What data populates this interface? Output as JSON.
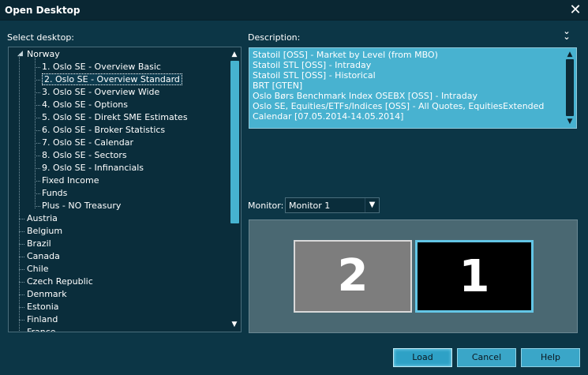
{
  "window": {
    "title": "Open Desktop",
    "close_label": "✕"
  },
  "labels": {
    "select_desktop": "Select desktop:",
    "description": "Description:",
    "monitor": "Monitor:"
  },
  "tree": {
    "root": "Norway",
    "children": [
      "1. Oslo SE - Overview Basic",
      "2. Oslo SE - Overview Standard",
      "3. Oslo SE - Overview Wide",
      "4. Oslo SE - Options",
      "5. Oslo SE - Direkt SME Estimates",
      "6. Oslo SE - Broker Statistics",
      "7. Oslo SE - Calendar",
      "8. Oslo SE - Sectors",
      "9. Oslo SE - Infinancials",
      "Fixed Income",
      "Funds",
      "Plus - NO Treasury"
    ],
    "selected_index": 1,
    "countries": [
      "Austria",
      "Belgium",
      "Brazil",
      "Canada",
      "Chile",
      "Czech Republic",
      "Denmark",
      "Estonia",
      "Finland",
      "France"
    ]
  },
  "description": {
    "lines": [
      "Statoil [OSS] - Market by Level (from MBO)",
      "Statoil STL [OSS] - Intraday",
      "Statoil STL [OSS] - Historical",
      "BRT [GTEN]",
      "Oslo Børs Benchmark Index OSEBX [OSS] - Intraday",
      "Oslo SE, Equities/ETFs/Indices [OSS] - All Quotes, EquitiesExtended",
      "Calendar [07.05.2014-14.05.2014]"
    ]
  },
  "monitor": {
    "selected": "Monitor 1",
    "screens": [
      "2",
      "1"
    ]
  },
  "buttons": {
    "load": "Load",
    "cancel": "Cancel",
    "help": "Help"
  },
  "icons": {
    "close": "close-icon",
    "collapse": "chevron-double-down-icon",
    "scroll_up": "scroll-up-icon",
    "scroll_down": "scroll-down-icon",
    "dropdown": "chevron-down-icon"
  },
  "colors": {
    "background": "#0c3646",
    "accent": "#48b2d0",
    "selected_monitor_border": "#63c6e6"
  }
}
